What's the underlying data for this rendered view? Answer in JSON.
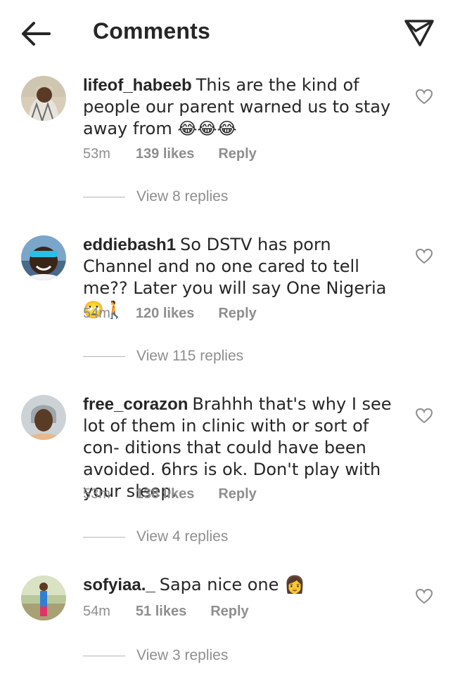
{
  "header": {
    "title": "Comments",
    "back_icon": "arrow-left-icon",
    "share_icon": "paper-plane-icon"
  },
  "comments": [
    {
      "username": "lifeof_habeeb",
      "text": "This are the kind of people our parent warned us to stay away from 😂😂😂",
      "time": "53m",
      "likes": "139 likes",
      "reply": "Reply",
      "view_replies": "View 8 replies"
    },
    {
      "username": "eddiebash1",
      "text": "So DSTV has porn Channel and no one cared to tell me?? Later you will say One Nigeria🙄🚶",
      "time": "54m",
      "likes": "120 likes",
      "reply": "Reply",
      "view_replies": "View 115 replies"
    },
    {
      "username": "free_corazon",
      "text": "Brahhh that's why I see lot of them in clinic with or sort of  con- ditions that could have been avoided. 6hrs is ok. Don't play with your sleep.",
      "time": "53m",
      "likes": "138 likes",
      "reply": "Reply",
      "view_replies": "View 4 replies"
    },
    {
      "username": "sofyiaa._",
      "text": "Sapa nice one 👩",
      "time": "54m",
      "likes": "51 likes",
      "reply": "Reply",
      "view_replies": "View 3 replies"
    }
  ],
  "colors": {
    "text": "#262626",
    "secondary": "#8e8e8e",
    "background": "#ffffff"
  }
}
